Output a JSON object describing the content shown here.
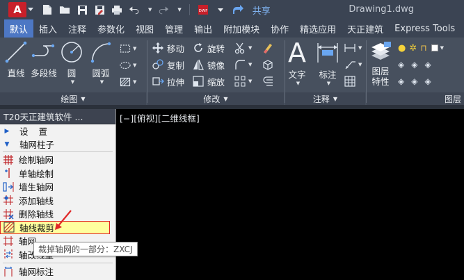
{
  "titlebar": {
    "logo_letter": "A",
    "share_label": "共享",
    "document_title": "Drawing1.dwg",
    "quick_access_icons": [
      "new-file-icon",
      "open-folder-icon",
      "save-icon",
      "save-as-icon",
      "print-icon",
      "undo-icon",
      "redo-icon",
      "dwf-publish-icon",
      "customize-dropdown-icon",
      "share-icon"
    ]
  },
  "ribbon_tabs": [
    {
      "label": "默认",
      "active": true
    },
    {
      "label": "插入"
    },
    {
      "label": "注释"
    },
    {
      "label": "参数化"
    },
    {
      "label": "视图"
    },
    {
      "label": "管理"
    },
    {
      "label": "输出"
    },
    {
      "label": "附加模块"
    },
    {
      "label": "协作"
    },
    {
      "label": "精选应用"
    },
    {
      "label": "天正建筑"
    },
    {
      "label": "Express Tools"
    }
  ],
  "ribbon": {
    "draw": {
      "panel_label": "绘图",
      "line": "直线",
      "polyline": "多段线",
      "circle": "圆",
      "arc": "圆弧"
    },
    "modify": {
      "panel_label": "修改",
      "move": "移动",
      "rotate": "旋转",
      "copy": "复制",
      "mirror": "镜像",
      "stretch": "拉伸",
      "scale": "缩放"
    },
    "annotation": {
      "panel_label": "注释",
      "text": "文字",
      "dimension": "标注",
      "text_glyph": "A"
    },
    "layers": {
      "panel_label": "图层",
      "layer_properties": "图层特性"
    }
  },
  "palette": {
    "title": "T20天正建筑软件 ...",
    "menu": [
      {
        "label": "设置",
        "expanded": false
      },
      {
        "label": "轴网柱子",
        "expanded": true
      }
    ],
    "commands": [
      {
        "label": "绘制轴网",
        "icon": "draw-grid-icon"
      },
      {
        "label": "单轴绘制",
        "icon": "single-axis-icon"
      },
      {
        "label": "墙生轴网",
        "icon": "wall-to-grid-icon"
      },
      {
        "label": "添加轴线",
        "icon": "add-axis-icon"
      },
      {
        "label": "删除轴线",
        "icon": "delete-axis-icon"
      },
      {
        "label": "轴线裁剪",
        "icon": "trim-axis-icon",
        "selected": true
      },
      {
        "label": "轴网",
        "icon": "grid-merge-icon"
      },
      {
        "label": "轴改线型",
        "icon": "axis-linetype-icon"
      }
    ],
    "commands_after_divider": [
      {
        "label": "轴网标注",
        "icon": "grid-dimension-icon"
      }
    ]
  },
  "viewport": {
    "label": "[−][俯视][二维线框]"
  },
  "tooltip": {
    "text": "裁掉轴网的一部分：ZXCJ"
  },
  "colors": {
    "titlebar_bg": "#3b4453",
    "active_tab": "#4d77c4",
    "ribbon_bg": "#47505e",
    "selected_row": "#ffff9e",
    "highlight_border": "#e02727"
  }
}
